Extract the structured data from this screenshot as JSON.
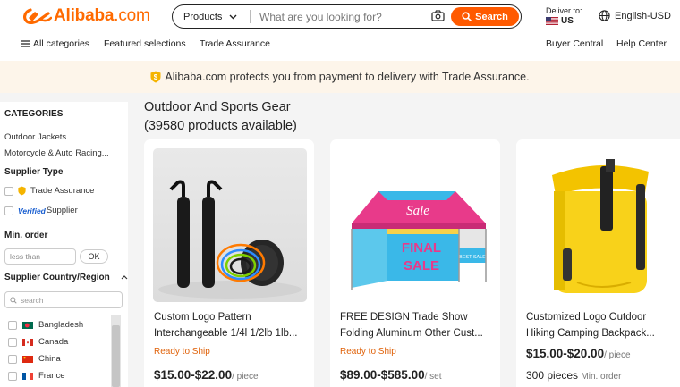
{
  "header": {
    "logo_text": "Alibaba",
    "logo_suffix": ".com",
    "search": {
      "category": "Products",
      "placeholder": "What are you looking for?",
      "button": "Search"
    },
    "deliver": {
      "label": "Deliver to:",
      "country": "US"
    },
    "language": "English-USD"
  },
  "nav": {
    "all_categories": "All categories",
    "featured": "Featured selections",
    "trade_assurance": "Trade Assurance",
    "buyer_central": "Buyer Central",
    "help_center": "Help Center"
  },
  "banner": {
    "text": "Alibaba.com protects you from payment to delivery with Trade Assurance."
  },
  "sidebar": {
    "categories_title": "CATEGORIES",
    "categories": [
      "Outdoor Jackets",
      "Motorcycle & Auto Racing..."
    ],
    "supplier_type_title": "Supplier Type",
    "supplier_types": [
      "Trade Assurance",
      "Verified Supplier"
    ],
    "verified_badge": "Verified",
    "supplier_label": "Supplier",
    "min_order_title": "Min. order",
    "min_order_placeholder": "less than",
    "ok_label": "OK",
    "country_title": "Supplier Country/Region",
    "country_search_placeholder": "search",
    "countries": [
      "Bangladesh",
      "Canada",
      "China",
      "France"
    ]
  },
  "main": {
    "title": "Outdoor And Sports Gear",
    "count": "(39580 products available)",
    "products": [
      {
        "name_line1": "Custom Logo Pattern",
        "name_line2": "Interchangeable 1/4l 1/2lb 1lb...",
        "badge": "Ready to Ship",
        "price": "$15.00-$22.00",
        "unit": "/ piece"
      },
      {
        "name_line1": "FREE DESIGN Trade Show",
        "name_line2": "Folding Aluminum Other Cust...",
        "badge": "Ready to Ship",
        "price": "$89.00-$585.00",
        "unit": "/ set",
        "tent_top_text": "Sale",
        "tent_wall_text1": "FINAL",
        "tent_wall_text2": "SALE",
        "tent_side_text": "BEST SALE"
      },
      {
        "name_line1": "Customized Logo Outdoor",
        "name_line2": "Hiking Camping Backpack...",
        "price": "$15.00-$20.00",
        "unit": "/ piece",
        "moq": "300 pieces",
        "moq_label": "Min. order"
      }
    ]
  },
  "colors": {
    "accent": "#ff6a00",
    "search_button": "#ff5a00",
    "ready_to_ship": "#e0620a",
    "banner_bg": "#fdf5ea"
  }
}
